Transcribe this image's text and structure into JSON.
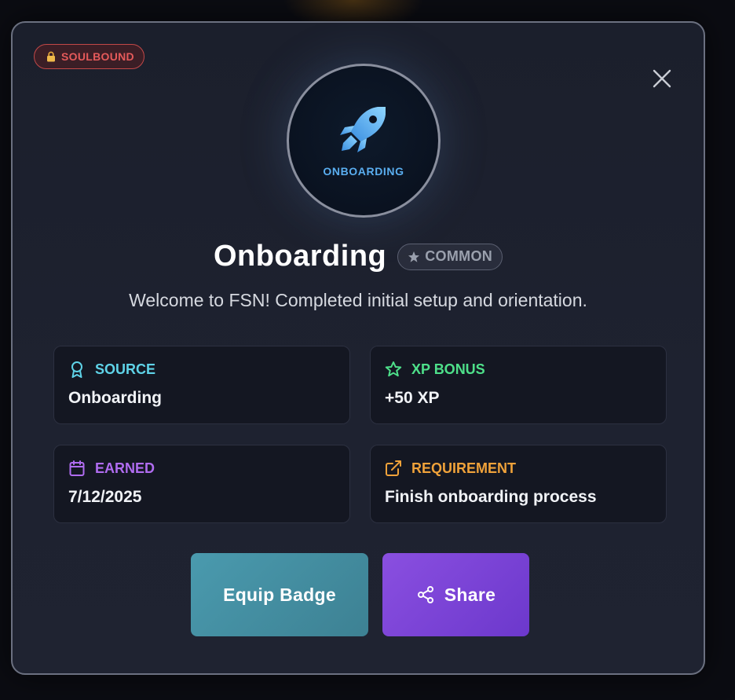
{
  "modal": {
    "soulbound_label": "SOULBOUND",
    "badge_emblem_label": "ONBOARDING",
    "title": "Onboarding",
    "rarity_label": "COMMON",
    "description": "Welcome to FSN! Completed initial setup and orientation."
  },
  "cards": {
    "source": {
      "label": "SOURCE",
      "value": "Onboarding",
      "color": "#5fd3e8",
      "icon": "ribbon-icon"
    },
    "xp_bonus": {
      "label": "XP BONUS",
      "value": "+50 XP",
      "color": "#4ee08a",
      "icon": "star-icon"
    },
    "earned": {
      "label": "EARNED",
      "value": "7/12/2025",
      "color": "#b06cf0",
      "icon": "calendar-icon"
    },
    "requirement": {
      "label": "REQUIREMENT",
      "value": "Finish onboarding process",
      "color": "#f0a23a",
      "icon": "external-link-icon"
    }
  },
  "buttons": {
    "equip_label": "Equip Badge",
    "share_label": "Share"
  },
  "colors": {
    "soulbound": "#e55a5a",
    "emblem_text": "#5aaef0",
    "equip_button": "#4a9aae",
    "share_button": "#7c45d8"
  }
}
